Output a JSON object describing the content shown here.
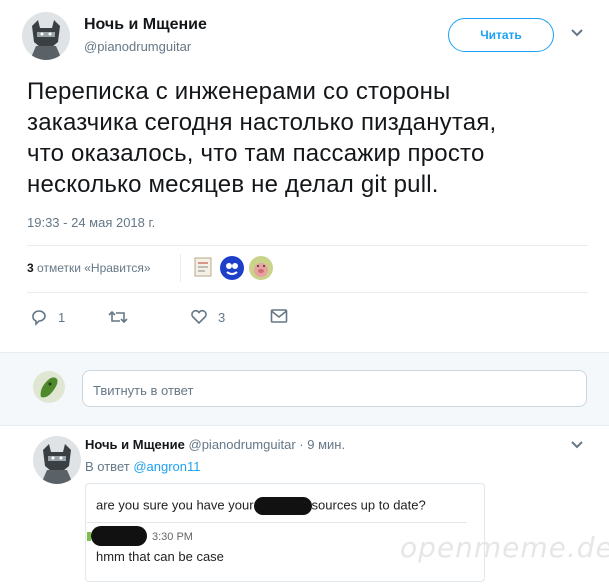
{
  "tweet": {
    "author_name": "Ночь и Мщение",
    "author_handle": "@pianodrumguitar",
    "follow_label": "Читать",
    "text_lines": [
      "Переписка с инженерами со стороны",
      "заказчика сегодня настолько пизданутая,",
      "что оказалось, что там пассажир просто",
      "несколько месяцев не делал git pull."
    ],
    "timestamp": "19:33 - 24 мая 2018 г.",
    "likes_count": "3",
    "likes_label": "отметки «Нравится»",
    "actions": {
      "reply_count": "1",
      "retweet_count": "",
      "like_count": "3"
    }
  },
  "reply_input": {
    "placeholder": "Твитнуть в ответ"
  },
  "reply_tweet": {
    "author_name": "Ночь и Мщение",
    "author_handle": "@pianodrumguitar",
    "time": "· 9 мин.",
    "in_reply_prefix": "В ответ",
    "in_reply_handle": "@angron11",
    "chat": {
      "line1_before": "are you sure you have your",
      "line1_after": "sources up to date?",
      "time": "3:30 PM",
      "line2": "hmm that can be case"
    }
  },
  "watermark": "openmeme.dev",
  "colors": {
    "accent": "#1da1f2",
    "secondary_text": "#657786",
    "divider": "#e6ecf0"
  }
}
